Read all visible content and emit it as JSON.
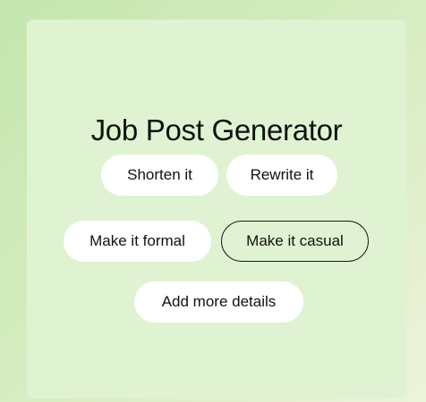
{
  "generator": {
    "title": "Job Post Generator",
    "options": [
      {
        "label": "Shorten it",
        "selected": false
      },
      {
        "label": "Rewrite it",
        "selected": false
      },
      {
        "label": "Make it formal",
        "selected": false
      },
      {
        "label": "Make it casual",
        "selected": true
      },
      {
        "label": "Add more details",
        "selected": false
      }
    ]
  },
  "colors": {
    "background_gradient_start": "#c5e6ae",
    "background_gradient_end": "#eef3dc",
    "card_background": "#dff3d2",
    "chip_background": "#ffffff",
    "text": "#111111",
    "selected_border": "#1a1a1a"
  }
}
